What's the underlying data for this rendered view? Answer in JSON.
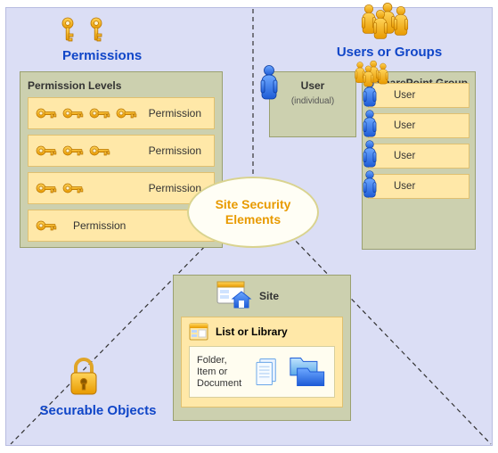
{
  "center": {
    "title": "Site Security Elements"
  },
  "permissions": {
    "title": "Permissions",
    "box_title": "Permission Levels",
    "row_label": "Permission"
  },
  "users": {
    "title": "Users or Groups",
    "user": {
      "title": "User",
      "sub": "(individual)"
    },
    "group": {
      "title": "SharePoint Group",
      "rows": [
        "User",
        "User",
        "User",
        "User"
      ]
    }
  },
  "securable": {
    "title": "Securable Objects",
    "site": {
      "title": "Site"
    },
    "library": {
      "title": "List or Library"
    },
    "document": {
      "text": "Folder, Item or Document"
    }
  }
}
